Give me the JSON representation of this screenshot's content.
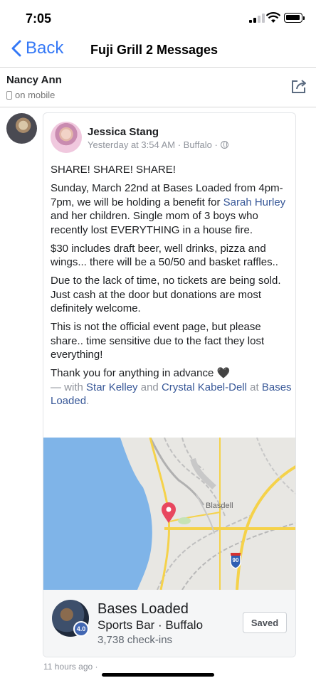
{
  "status_bar": {
    "time": "7:05"
  },
  "nav": {
    "back_label": "Back",
    "title": "Fuji Grill 2 Messages"
  },
  "contact": {
    "name": "Nancy Ann",
    "status": "on mobile"
  },
  "post": {
    "author": "Jessica Stang",
    "meta": "Yesterday at 3:54 AM · Buffalo ·",
    "p1": "SHARE! SHARE! SHARE!",
    "p2_a": "Sunday, March 22nd at Bases Loaded from 4pm-7pm, we will be holding a benefit for ",
    "p2_link": "Sarah Hurley",
    "p2_b": " and her children. Single mom of 3 boys who recently lost EVERYTHING in a house fire.",
    "p3": "$30 includes draft beer, well drinks, pizza and wings... there will be a 50/50 and basket raffles..",
    "p4": "Due to the lack of time, no tickets are being sold. Just cash at the door but donations are most definitely welcome.",
    "p5": "This is not the official event page, but please share.. time sensitive due to the fact they lost everything!",
    "p6": "Thank you for anything in advance",
    "p6_emoji": "🖤",
    "with_prefix": " — with ",
    "tag1": "Star Kelley",
    "and": " and ",
    "tag2": "Crystal Kabel-Dell",
    "at": " at ",
    "location_link": "Bases Loaded",
    "period": "."
  },
  "map": {
    "place_label": "Blasdell",
    "highway_shield": "90"
  },
  "place": {
    "name": "Bases Loaded",
    "category": "Sports Bar · Buffalo",
    "checkins": "3,738 check-ins",
    "rating": "4.0",
    "saved_label": "Saved"
  },
  "footer": {
    "timestamp": "11 hours ago ·"
  },
  "colors": {
    "ios_blue": "#3478f6",
    "fb_link": "#385898",
    "map_water": "#7fb4e8",
    "map_pin": "#e8475f"
  }
}
